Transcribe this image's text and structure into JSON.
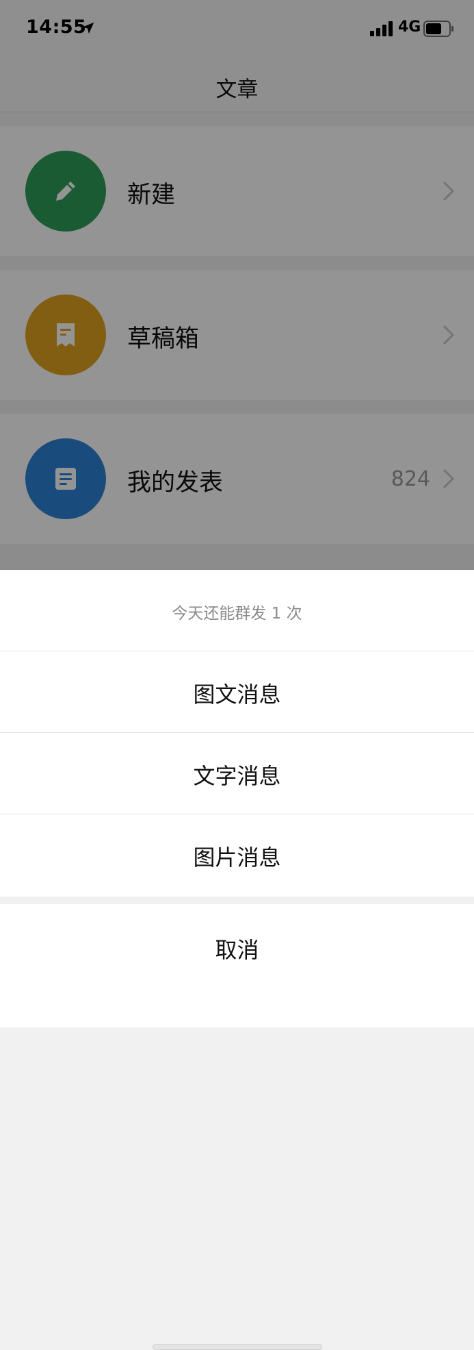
{
  "status_bar": {
    "time": "14:55",
    "network": "4G",
    "icons": [
      "location-arrow-icon",
      "signal-bars-icon",
      "battery-icon"
    ]
  },
  "nav": {
    "title": "文章"
  },
  "list": {
    "items": [
      {
        "label": "新建",
        "icon": "pencil-icon",
        "icon_color": "#2f9e59"
      },
      {
        "label": "草稿箱",
        "icon": "draft-receipt-icon",
        "icon_color": "#e0a21f"
      },
      {
        "label": "我的发表",
        "icon": "document-icon",
        "icon_color": "#2c82d6",
        "count": "824"
      }
    ]
  },
  "action_sheet": {
    "header": "今天还能群发 1 次",
    "options": [
      {
        "label": "图文消息"
      },
      {
        "label": "文字消息"
      },
      {
        "label": "图片消息"
      }
    ],
    "cancel": "取消"
  },
  "colors": {
    "overlay": "#000000",
    "chevron": "#c7c7cc",
    "count_text": "#9a9a9a",
    "header_text": "#8a8a8a"
  }
}
